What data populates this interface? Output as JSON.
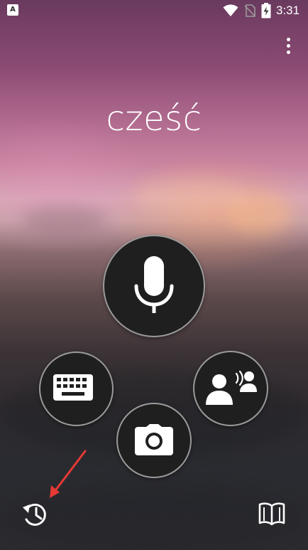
{
  "status_bar": {
    "app_icon_letter": "A",
    "time": "3:31",
    "icons": [
      "wifi-icon",
      "no-sim-icon",
      "battery-charging-icon"
    ]
  },
  "main": {
    "greeting": "cześć"
  },
  "actions": {
    "microphone": "microphone-icon",
    "keyboard": "keyboard-icon",
    "camera": "camera-icon",
    "conversation": "conversation-icon"
  },
  "bottom_bar": {
    "history": "history-icon",
    "phrasebook": "book-icon"
  },
  "colors": {
    "button_fill": "#1f1f1f",
    "icon": "#ffffff",
    "annotation_arrow": "#e53935"
  }
}
